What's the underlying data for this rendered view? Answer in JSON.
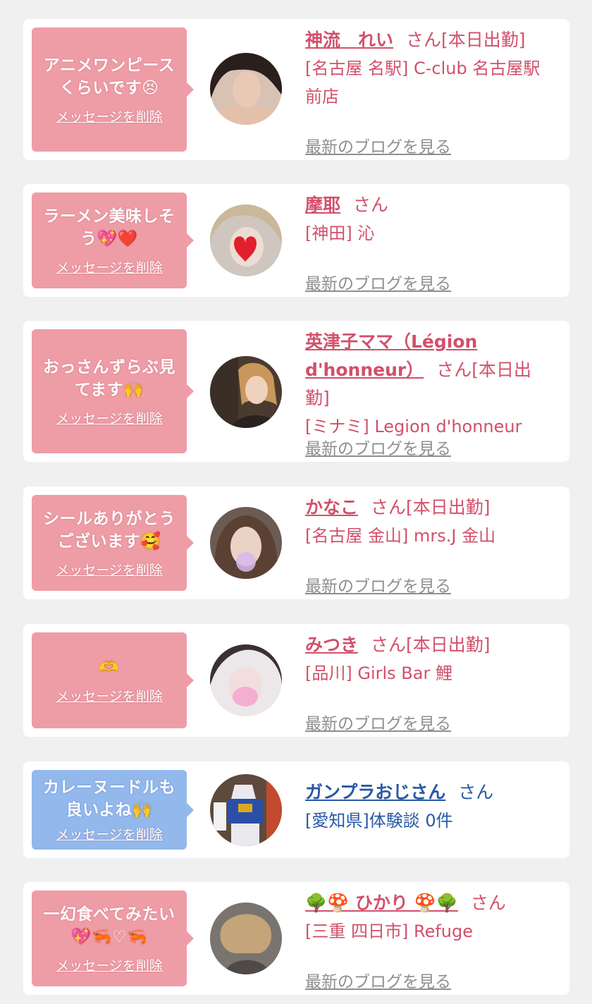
{
  "delete_label": "メッセージを削除",
  "blog_label": "最新のブログを見る",
  "colors": {
    "pink_bubble": "#ee9da7",
    "blue_bubble": "#93b8ec",
    "pink_text": "#d2506a",
    "blue_text": "#2859a6",
    "blog_link": "#8f8f8f",
    "background": "#f0f0f0"
  },
  "cards": [
    {
      "message": "アニメワンピース\nくらいです😣",
      "name": "神流　れい",
      "suffix": "さん[本日出勤]",
      "shop": "[名古屋 名駅] C-club 名古屋駅前店",
      "avatar_icon": "profile-photo"
    },
    {
      "message": "ラーメン美味しそ\nう💖❤️",
      "name": "摩耶",
      "suffix": "さん",
      "shop": "[神田] 沁",
      "avatar_icon": "profile-photo"
    },
    {
      "message": "おっさんずらぶ見\nてます🙌",
      "name": "英津子ママ（Légion d'honneur）",
      "suffix": "さん[本日出勤]",
      "shop": "[ミナミ] Legion d'honneur",
      "avatar_icon": "profile-photo"
    },
    {
      "message": "シールありがとう\nございます🥰",
      "name": "かなこ",
      "suffix": "さん[本日出勤]",
      "shop": "[名古屋 金山] mrs.J 金山",
      "avatar_icon": "profile-photo"
    },
    {
      "message": "🫶",
      "name": "みつき",
      "suffix": "さん[本日出勤]",
      "shop": "[品川] Girls Bar 鯉",
      "avatar_icon": "profile-photo"
    },
    {
      "message": "カレーヌードルも\n良いよね🙌",
      "name": "ガンプラおじさん",
      "suffix": "さん",
      "shop": "[愛知県]体験談 0件",
      "avatar_icon": "robot-photo"
    },
    {
      "message": "一幻食べてみたい\n💖🦐♡🦐",
      "name": "🌳🍄 ひかり 🍄🌳",
      "suffix": "さん",
      "shop": "[三重 四日市] Refuge",
      "avatar_icon": "profile-photo"
    }
  ]
}
